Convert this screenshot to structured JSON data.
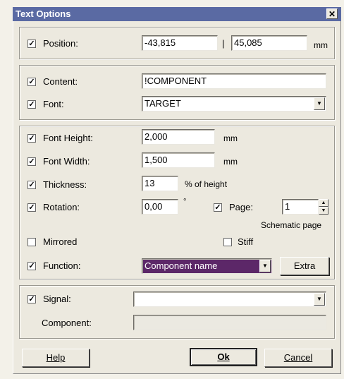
{
  "window": {
    "title": "Text Options",
    "close_glyph": "✕"
  },
  "position": {
    "label": "Position:",
    "checked": true,
    "x_value": "-43,815",
    "separator": "|",
    "y_value": "45,085",
    "unit": "mm"
  },
  "content": {
    "label": "Content:",
    "checked": true,
    "value": "!COMPONENT"
  },
  "font": {
    "label": "Font:",
    "checked": true,
    "value": "TARGET"
  },
  "font_height": {
    "label": "Font Height:",
    "checked": true,
    "value": "2,000",
    "unit": "mm"
  },
  "font_width": {
    "label": "Font Width:",
    "checked": true,
    "value": "1,500",
    "unit": "mm"
  },
  "thickness": {
    "label": "Thickness:",
    "checked": true,
    "value": "13",
    "unit": "% of height"
  },
  "rotation": {
    "label": "Rotation:",
    "checked": true,
    "value": "0,00",
    "unit": "°"
  },
  "page": {
    "label": "Page:",
    "checked": true,
    "value": "1",
    "caption": "Schematic page"
  },
  "mirrored": {
    "label": "Mirrored",
    "checked": false
  },
  "stiff": {
    "label": "Stiff",
    "checked": false
  },
  "function": {
    "label": "Function:",
    "checked": true,
    "value": "Component name",
    "extra_button": "Extra"
  },
  "signal": {
    "label": "Signal:",
    "checked": true,
    "value": ""
  },
  "component": {
    "label": "Component:",
    "value": ""
  },
  "buttons": {
    "help": "Help",
    "ok": "Ok",
    "cancel": "Cancel"
  },
  "colors": {
    "titlebar": "#5a6aa3",
    "selection": "#5c2768",
    "dialog": "#ece9df"
  }
}
